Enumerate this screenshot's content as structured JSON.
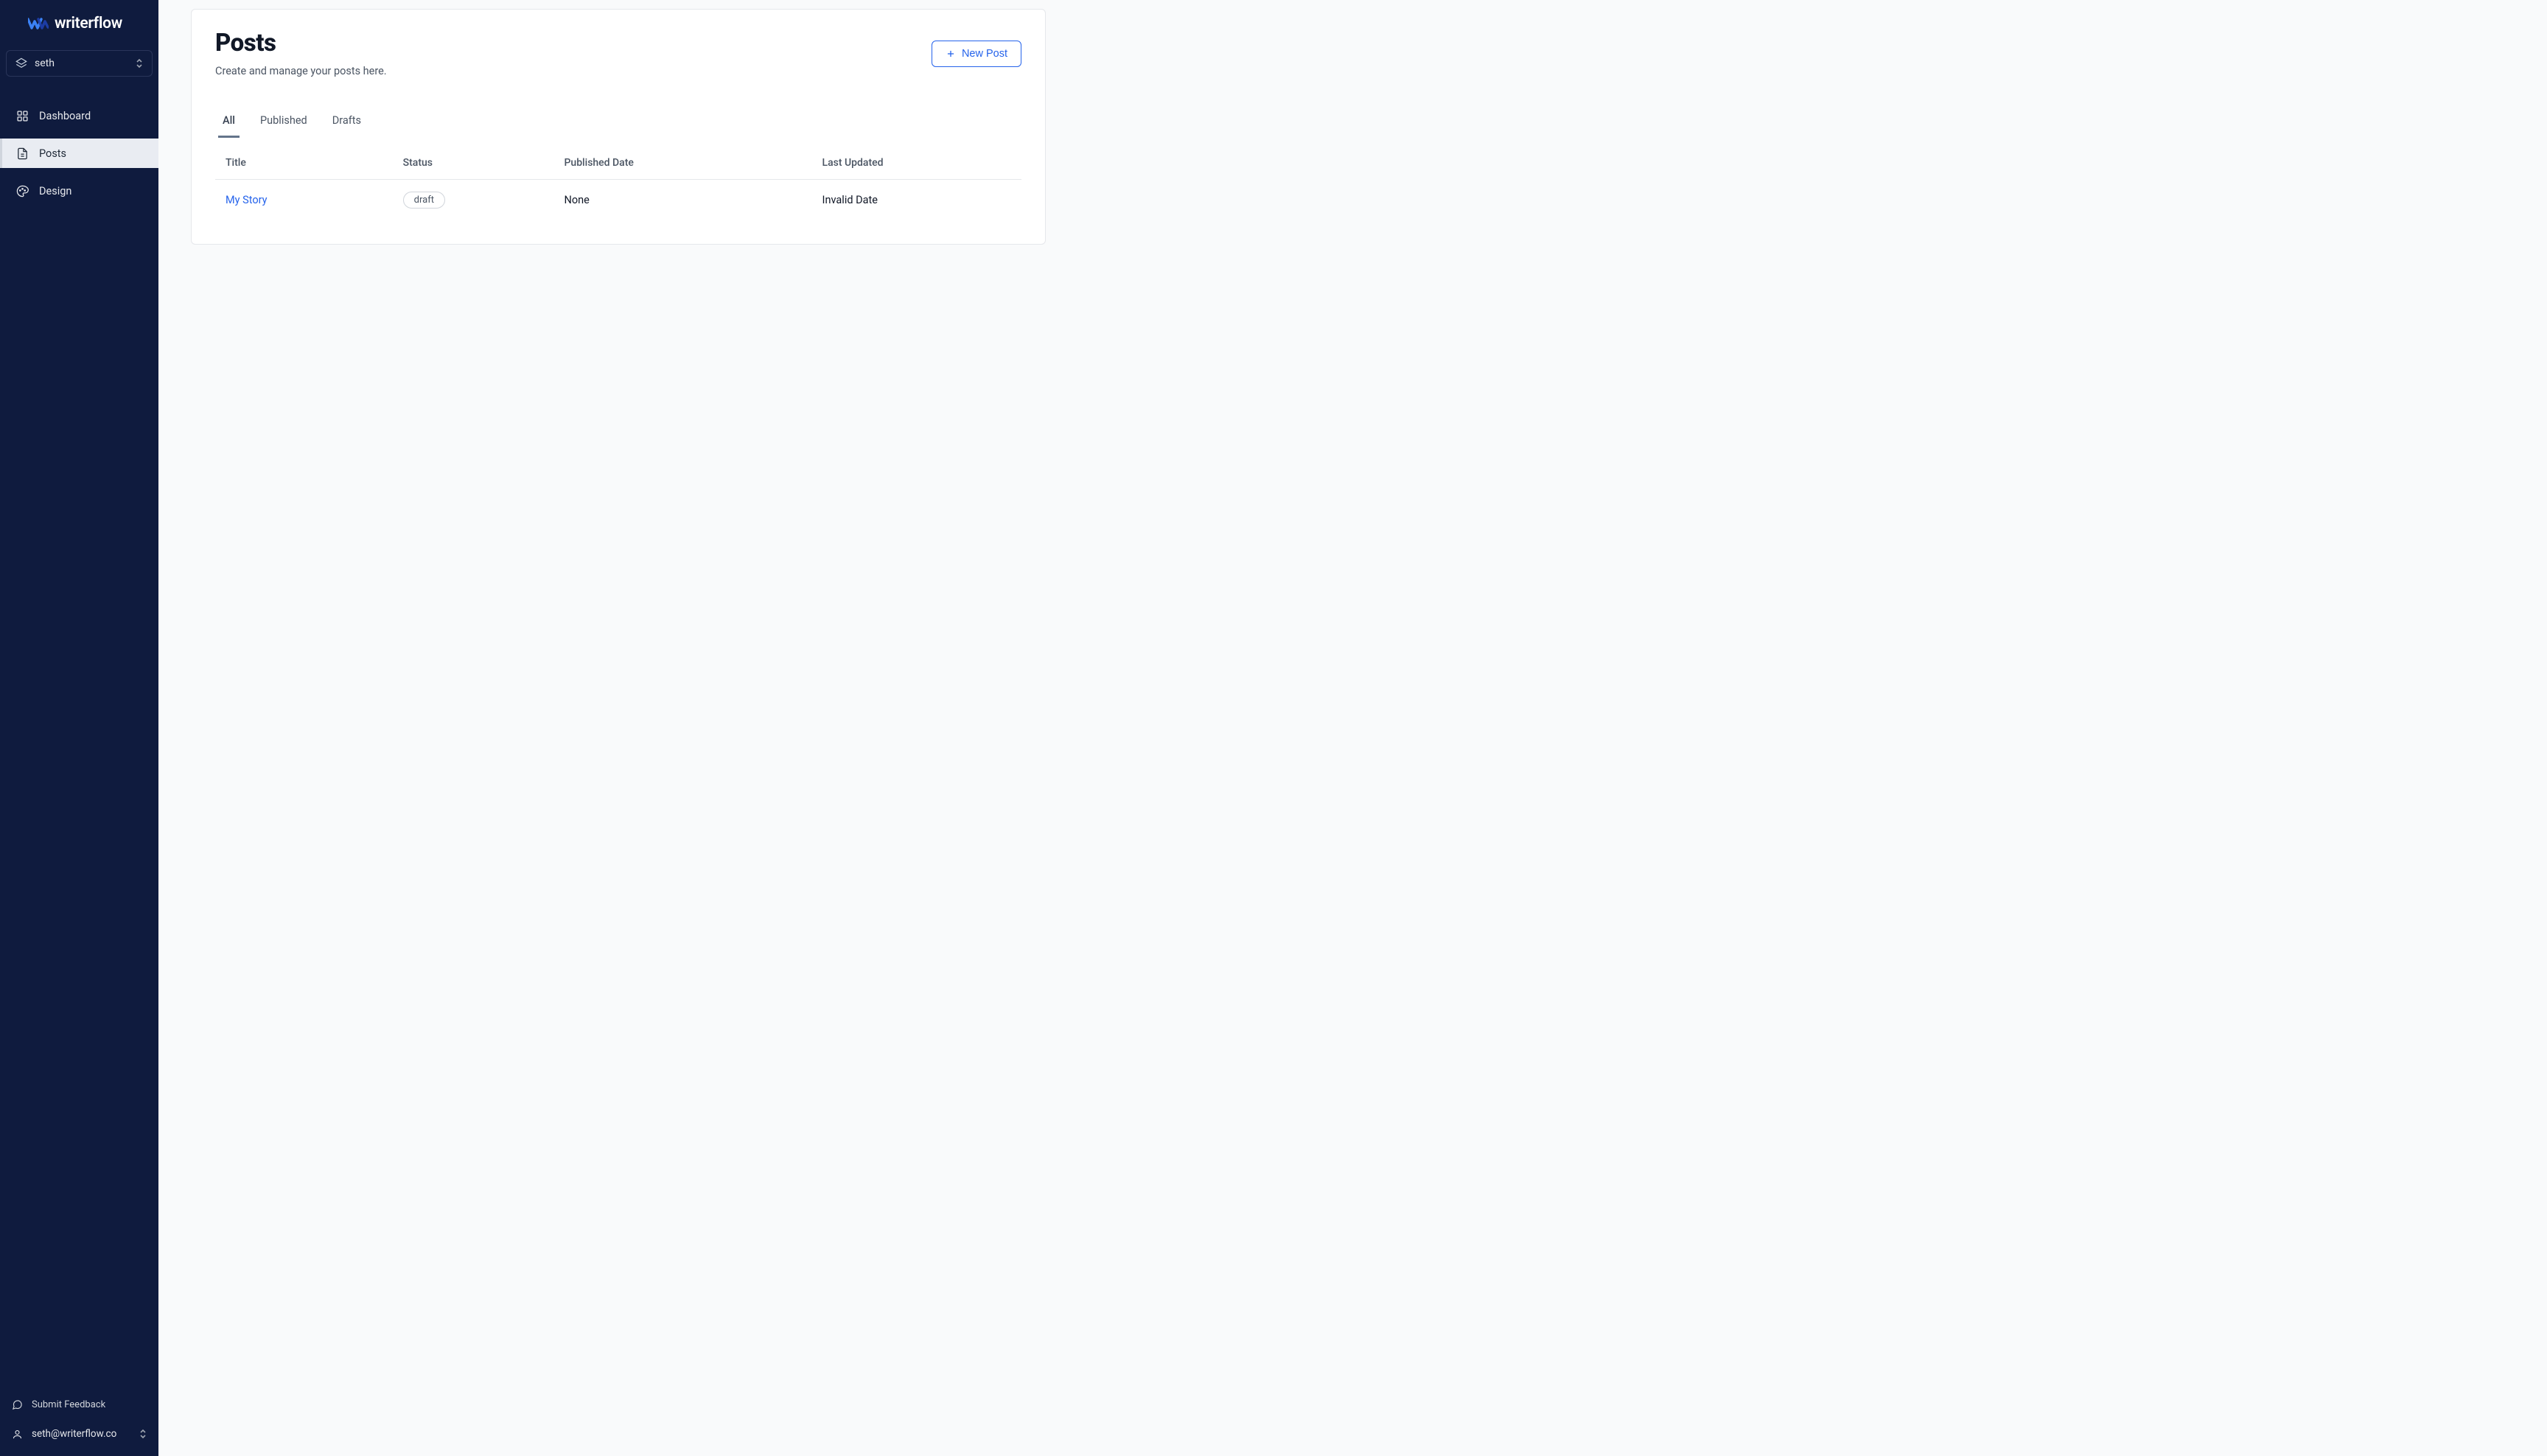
{
  "brand": {
    "name": "writerflow"
  },
  "org": {
    "name": "seth"
  },
  "nav": {
    "items": [
      {
        "label": "Dashboard",
        "icon": "grid"
      },
      {
        "label": "Posts",
        "icon": "document",
        "active": true
      },
      {
        "label": "Design",
        "icon": "palette"
      }
    ]
  },
  "footer": {
    "feedback_label": "Submit Feedback",
    "user_email": "seth@writerflow.co"
  },
  "page": {
    "title": "Posts",
    "subtitle": "Create and manage your posts here.",
    "new_button_label": "New Post"
  },
  "tabs": {
    "items": [
      {
        "label": "All",
        "active": true
      },
      {
        "label": "Published"
      },
      {
        "label": "Drafts"
      }
    ]
  },
  "table": {
    "columns": [
      "Title",
      "Status",
      "Published Date",
      "Last Updated"
    ],
    "rows": [
      {
        "title": "My Story",
        "status": "draft",
        "published": "None",
        "updated": "Invalid Date"
      }
    ]
  }
}
